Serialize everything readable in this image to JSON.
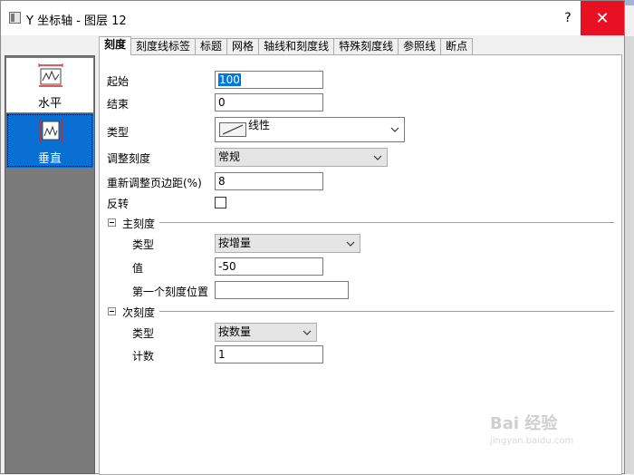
{
  "window": {
    "title": "Y 坐标轴 - 图层 12",
    "help": "?",
    "close": "✕"
  },
  "sidebar": {
    "items": [
      {
        "label": "水平"
      },
      {
        "label": "垂直"
      }
    ]
  },
  "tabs": [
    "刻度",
    "刻度线标签",
    "标题",
    "网格",
    "轴线和刻度线",
    "特殊刻度线",
    "参照线",
    "断点"
  ],
  "form": {
    "start": {
      "label": "起始",
      "value": "100"
    },
    "end": {
      "label": "结束",
      "value": "0"
    },
    "type": {
      "label": "类型",
      "value": "线性"
    },
    "rescale": {
      "label": "调整刻度",
      "value": "常规"
    },
    "rescale_margin": {
      "label": "重新调整页边距(%)",
      "value": "8"
    },
    "reverse": {
      "label": "反转"
    }
  },
  "major": {
    "title": "主刻度",
    "type": {
      "label": "类型",
      "value": "按增量"
    },
    "value": {
      "label": "值",
      "value": "-50"
    },
    "first_tick": {
      "label": "第一个刻度位置",
      "value": ""
    }
  },
  "minor": {
    "title": "次刻度",
    "type": {
      "label": "类型",
      "value": "按数量"
    },
    "count": {
      "label": "计数",
      "value": "1"
    }
  },
  "watermark": {
    "text": "Bai 经验",
    "url": "jingyan.baidu.com"
  }
}
